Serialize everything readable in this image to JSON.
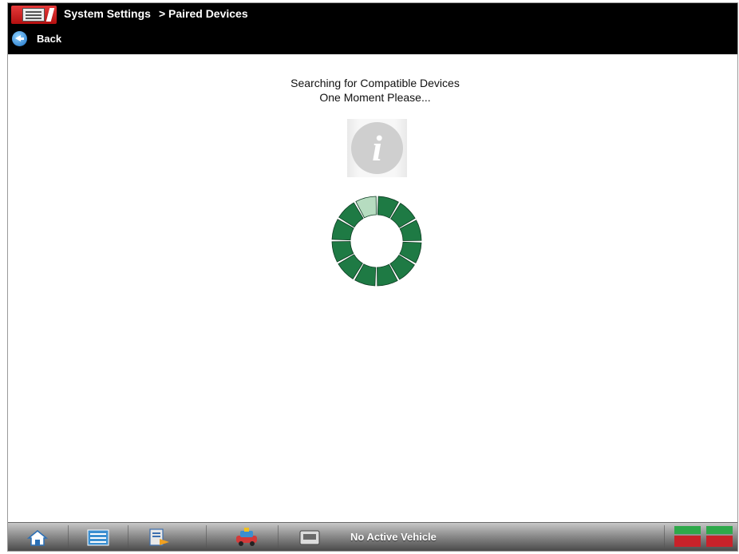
{
  "header": {
    "title": "System Settings",
    "breadcrumb": "> Paired Devices",
    "back_label": "Back",
    "app_icon": "system-settings-icon"
  },
  "main": {
    "message_line1": "Searching for Compatible Devices",
    "message_line2": "One Moment Please...",
    "info_icon": "info-icon",
    "info_glyph": "i",
    "spinner": {
      "segments": 12,
      "highlighted_segment": 0,
      "color": "#1e7a44",
      "highlight_color": "#b6dcc0"
    }
  },
  "footer": {
    "buttons": [
      {
        "name": "home-button",
        "icon": "home-icon"
      },
      {
        "name": "toolbox-button",
        "icon": "toolbox-icon"
      },
      {
        "name": "data-button",
        "icon": "data-icon"
      },
      {
        "name": "vehicle-button",
        "icon": "vehicle-icon"
      },
      {
        "name": "scanner-button",
        "icon": "scanner-icon"
      }
    ],
    "status": "No Active Vehicle",
    "indicators": [
      "wireless-status-icon",
      "battery-status-icon"
    ]
  },
  "colors": {
    "header_bg": "#000000",
    "spinner_green": "#1e7a44",
    "brand_red": "#c81e1e"
  }
}
